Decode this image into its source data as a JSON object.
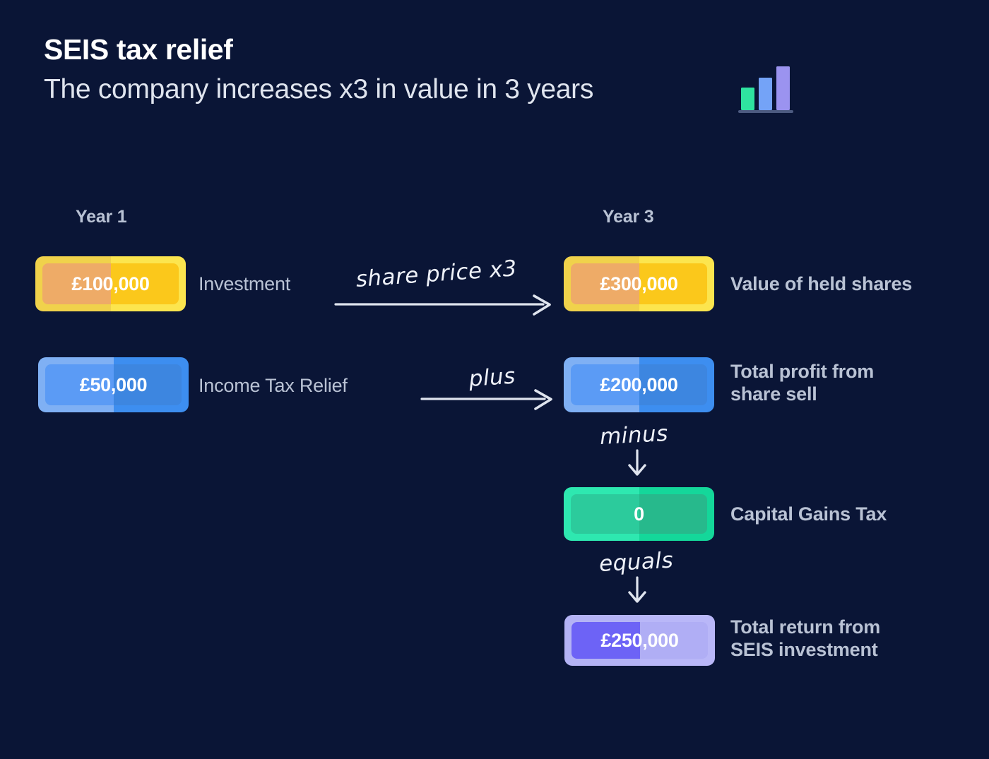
{
  "background_color": "#0a1536",
  "header": {
    "title": "SEIS tax relief",
    "subtitle": "The company increases x3 in value in 3 years",
    "icon_name": "bar-chart-icon",
    "icon_bars": [
      {
        "name": "bar-green",
        "color": "#2fe3a0",
        "height_pct": 48
      },
      {
        "name": "bar-blue",
        "color": "#74a3f7",
        "height_pct": 74
      },
      {
        "name": "bar-purple",
        "color": "#9b93f0",
        "height_pct": 100
      }
    ],
    "icon_baseline_color": "#4c5a80"
  },
  "columns": {
    "year1_label": "Year 1",
    "year3_label": "Year 3"
  },
  "pills": {
    "investment": {
      "value": "£100,000",
      "label": "Investment",
      "outer_left": "#f0d24b",
      "outer_right": "#fce54e",
      "inner_left": "#eeab67",
      "inner_right": "#fbc81b"
    },
    "income_tax_relief": {
      "value": "£50,000",
      "label": "Income Tax Relief",
      "outer_left": "#7fb0f4",
      "outer_right": "#3d8ef0",
      "inner_left": "#5b9bf5",
      "inner_right": "#3d86e0"
    },
    "value_of_held_shares": {
      "value": "£300,000",
      "label": "Value of held shares",
      "outer_left": "#f0d24b",
      "outer_right": "#fce54e",
      "inner_left": "#eeab67",
      "inner_right": "#fbc81b"
    },
    "total_profit": {
      "value": "£200,000",
      "label_line1": "Total profit from",
      "label_line2": "share sell",
      "outer_left": "#7fb0f4",
      "outer_right": "#3d8ef0",
      "inner_left": "#5b9bf5",
      "inner_right": "#3d86e0"
    },
    "capital_gains_tax": {
      "value": "0",
      "label": "Capital Gains Tax",
      "outer_left": "#2ee8b0",
      "outer_right": "#14d79a",
      "inner_left": "#2ccb9c",
      "inner_right": "#27b98c"
    },
    "total_return": {
      "value": "£250,000",
      "label_line1": "Total return from",
      "label_line2": "SEIS  investment",
      "outer_left": "#b4b3f5",
      "outer_right": "#b9b7f8",
      "inner_left": "#6d63f6",
      "inner_right": "#b0aef5"
    }
  },
  "connectors": {
    "share_price": {
      "text": "share price x3",
      "arrow": "arrow-right"
    },
    "plus": {
      "text": "plus",
      "arrow": "arrow-right"
    },
    "minus": {
      "text": "minus",
      "arrow": "arrow-down"
    },
    "equals": {
      "text": "equals",
      "arrow": "arrow-down"
    }
  },
  "chart_data": {
    "type": "bar",
    "title": "SEIS tax relief",
    "subtitle": "The company increases x3 in value in 3 years",
    "xlabel": "",
    "ylabel": "GBP",
    "categories": [
      "Investment (Year 1)",
      "Income Tax Relief (Year 1)",
      "Value of held shares (Year 3)",
      "Total profit from share sell (Year 3)",
      "Capital Gains Tax (Year 3)",
      "Total return from SEIS investment (Year 3)"
    ],
    "values": [
      100000,
      50000,
      300000,
      200000,
      0,
      250000
    ],
    "value_labels": [
      "£100,000",
      "£50,000",
      "£300,000",
      "£200,000",
      "0",
      "£250,000"
    ],
    "colors": [
      "#fbc81b",
      "#3d86e0",
      "#fbc81b",
      "#3d86e0",
      "#27b98c",
      "#6d63f6"
    ],
    "grid": false,
    "legend": "none",
    "annotations": [
      "share price x3",
      "plus",
      "minus",
      "equals"
    ],
    "icon_series": {
      "name": "growth",
      "values": [
        48,
        74,
        100
      ]
    }
  }
}
